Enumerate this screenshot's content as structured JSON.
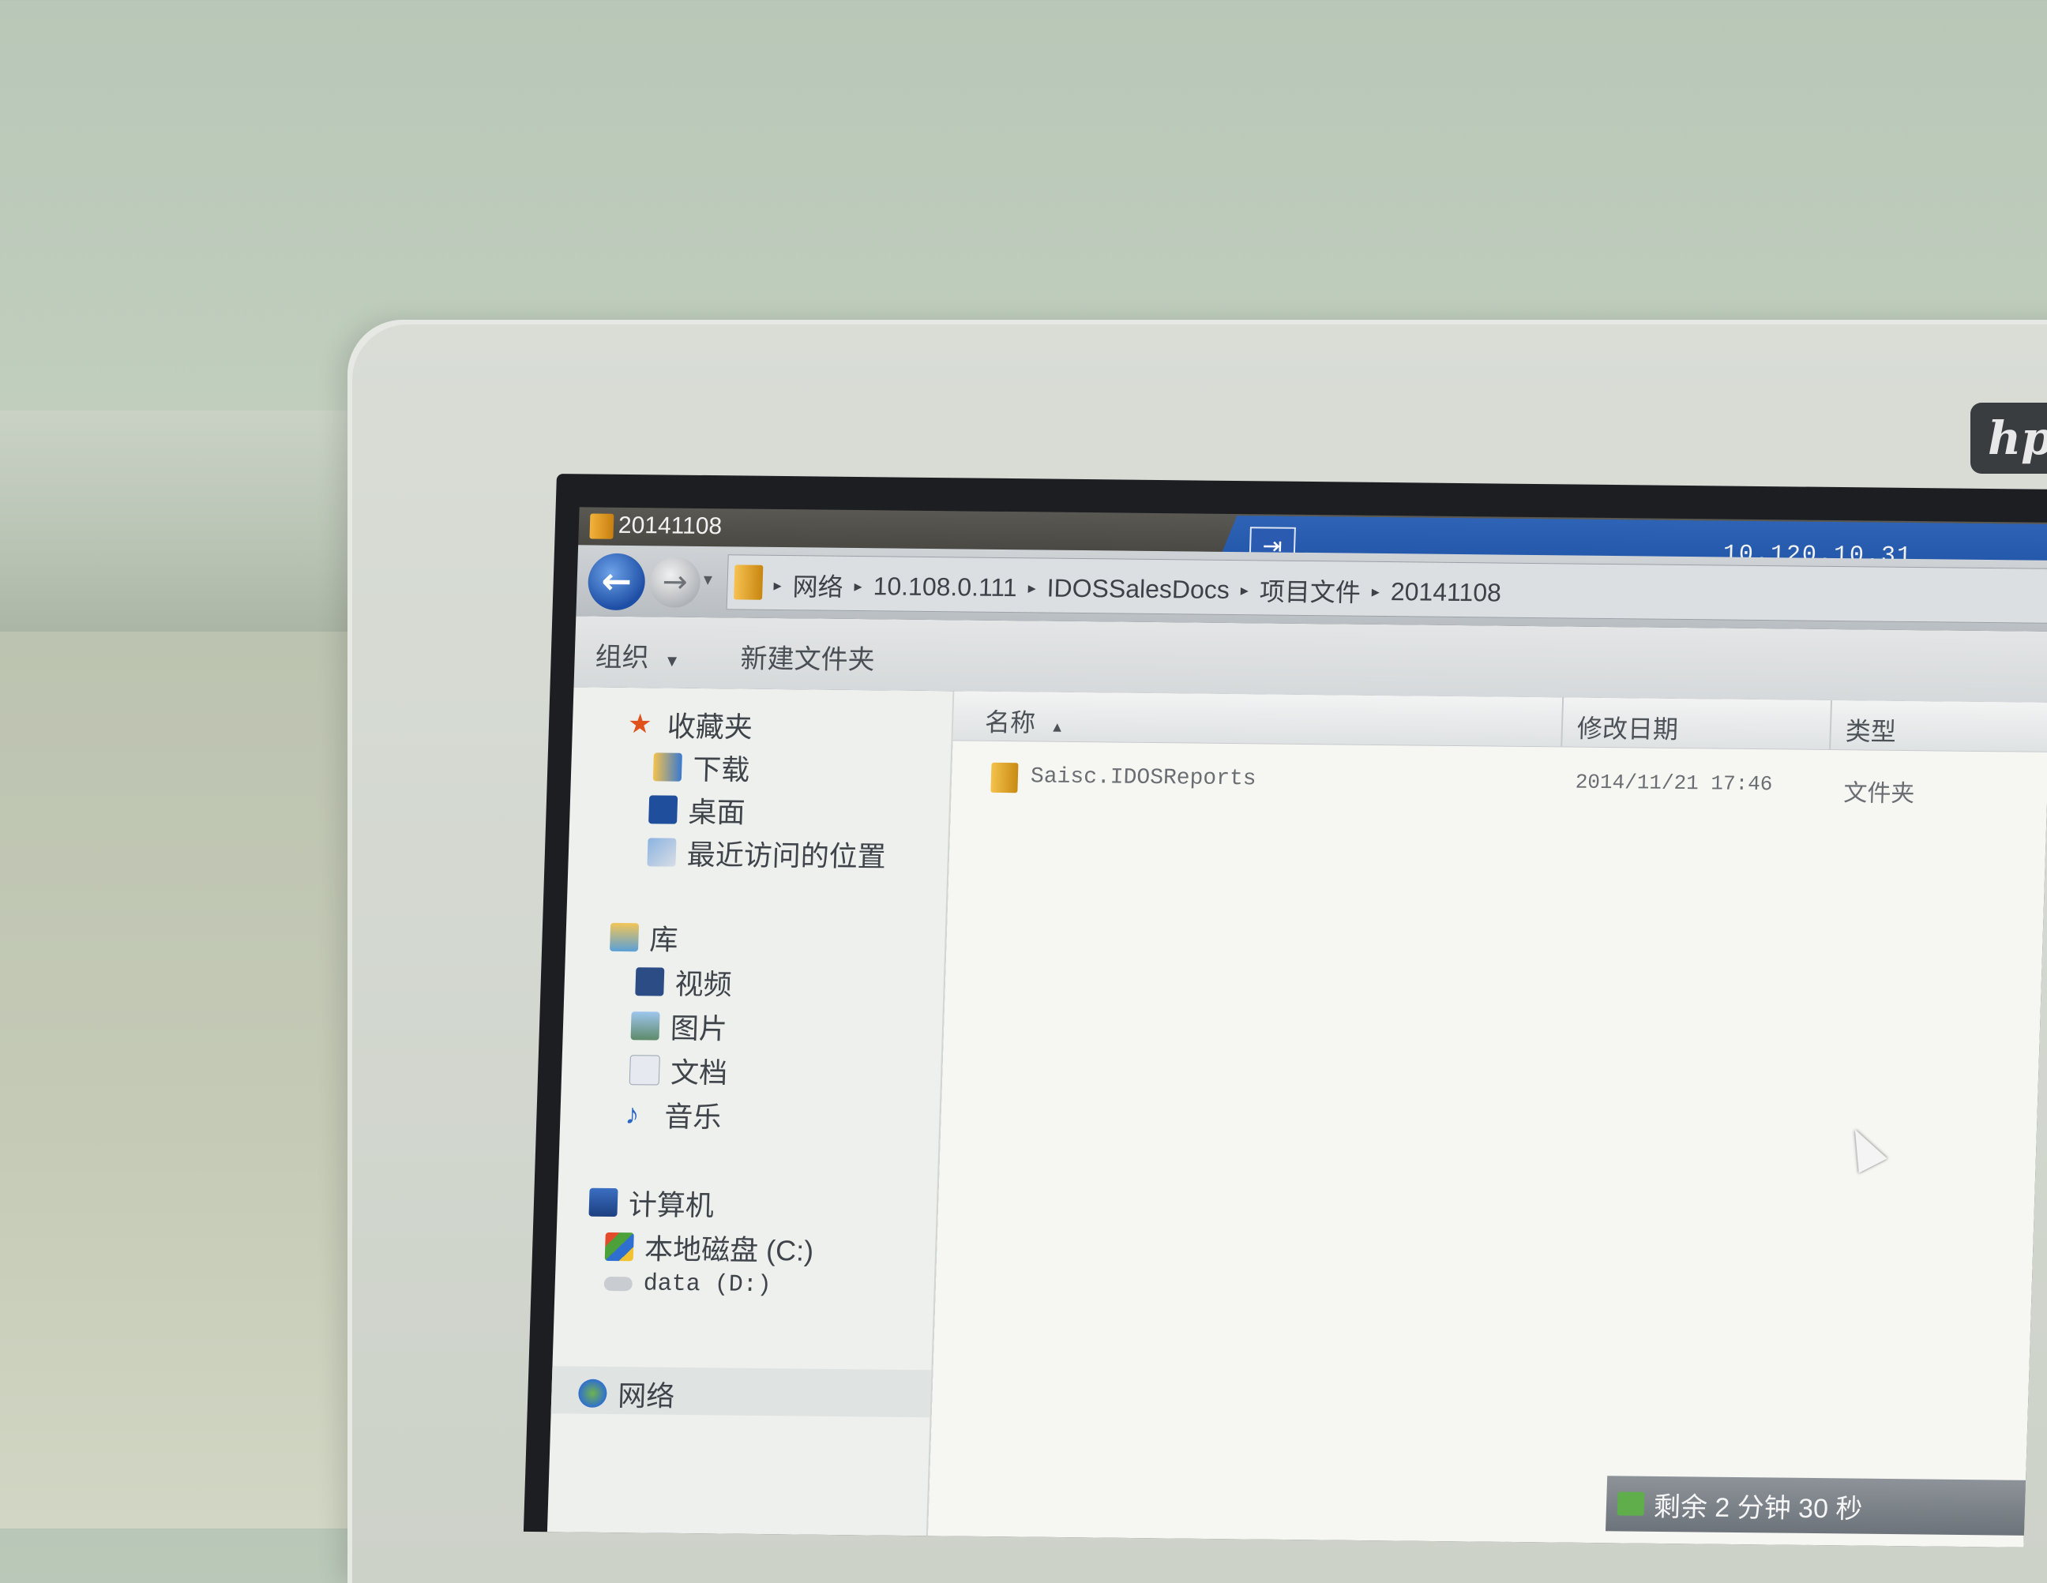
{
  "window": {
    "title": "20141108",
    "remote_ip": "10.120.10.31",
    "pin_symbol": "⇥"
  },
  "nav_buttons": {
    "back_symbol": "←",
    "forward_symbol": "→",
    "history_symbol": "▾"
  },
  "breadcrumbs": [
    "网络",
    "10.108.0.111",
    "IDOSSalesDocs",
    "项目文件",
    "20141108"
  ],
  "breadcrumb_separator": "▸",
  "toolbar": {
    "organize_label": "组织",
    "organize_arrow": "▾",
    "new_folder_label": "新建文件夹"
  },
  "navigation": {
    "favorites": {
      "label": "收藏夹",
      "items": [
        "下载",
        "桌面",
        "最近访问的位置"
      ]
    },
    "libraries": {
      "label": "库",
      "items": [
        "视频",
        "图片",
        "文档",
        "音乐"
      ]
    },
    "computer": {
      "label": "计算机",
      "items": [
        "本地磁盘 (C:)",
        "data (D:)"
      ]
    },
    "network": {
      "label": "网络"
    }
  },
  "columns": {
    "name": "名称",
    "name_sort_icon": "▲",
    "modified": "修改日期",
    "type": "类型"
  },
  "files": [
    {
      "name": "Saisc.IDOSReports",
      "modified": "2014/11/21 17:46",
      "type": "文件夹"
    }
  ],
  "countdown_text": "剩余 2 分钟 30 秒",
  "monitor_logo": "hp",
  "colors": {
    "accent_blue": "#1c4fa2",
    "folder_yellow": "#f3b33a",
    "nav_background": "#eef0ee"
  }
}
